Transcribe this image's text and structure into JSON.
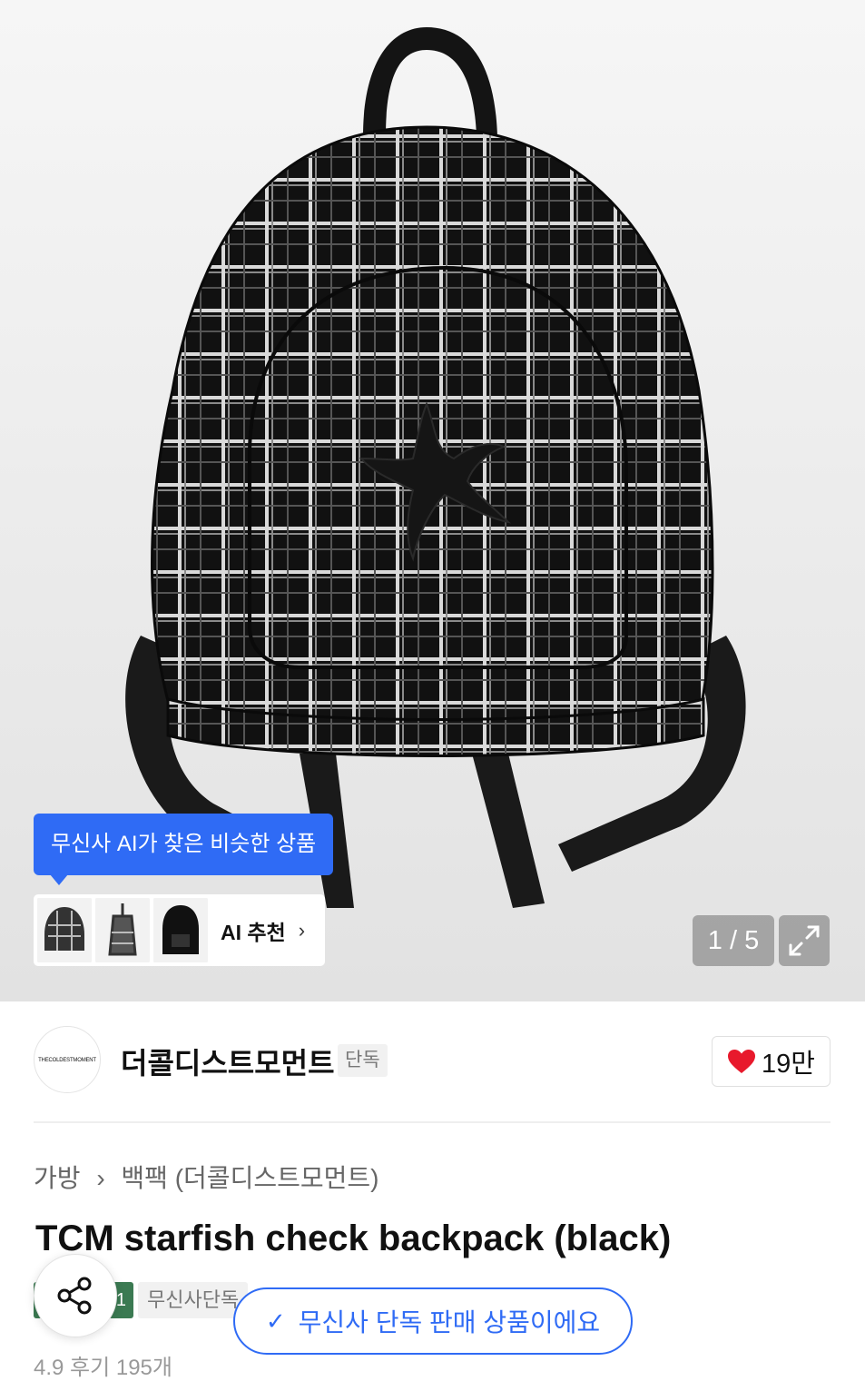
{
  "hero": {
    "ai_tooltip": "무신사 AI가 찾은 비슷한 상품",
    "ai_card_label": "AI 추천",
    "image_counter": "1 / 5"
  },
  "brand": {
    "logo_text": "THECOLDESTMOMENT",
    "name": "더콜디스트모먼트",
    "tag": "단독",
    "likes": "19만"
  },
  "breadcrumb": {
    "category": "가방",
    "subcategory": "백팩 (더콜디스트모먼트)"
  },
  "product": {
    "title": "TCM starfish check backpack (black)",
    "badge_green": "1",
    "badge_grey": "무신사단독",
    "rating_partial": "4.9 후기 195개"
  },
  "floating": {
    "exclusive_notice": "무신사 단독 판매 상품이에요"
  },
  "colors": {
    "accent_blue": "#2f6bf5",
    "heart_red": "#e8192c"
  },
  "icons": [
    "expand-icon",
    "heart-icon",
    "share-icon",
    "check-icon",
    "chevron-right-icon"
  ]
}
